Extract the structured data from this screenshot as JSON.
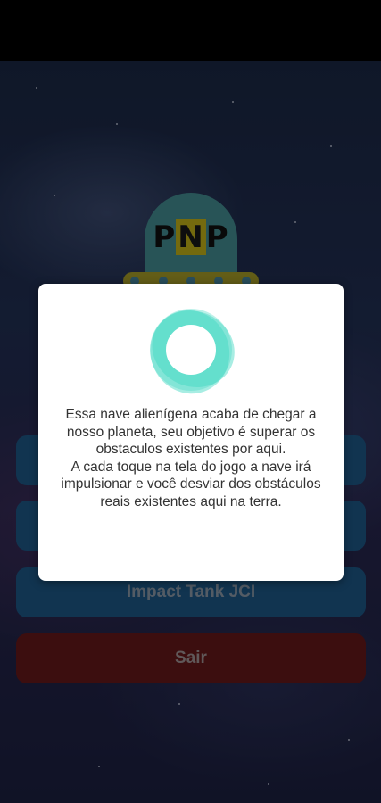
{
  "logo": {
    "letters": [
      "P",
      "N",
      "P"
    ]
  },
  "menu": {
    "impact_label": "Impact Tank JCI",
    "exit_label": "Sair"
  },
  "dialog": {
    "paragraph1": "Essa nave alienígena acaba de chegar a nosso planeta, seu objetivo é superar os obstaculos existentes por aqui.",
    "paragraph2": "A cada toque na tela do jogo a nave irá impulsionar e você desviar dos obstáculos reais existentes aqui na terra.",
    "loader_icon": "spinner-icon"
  },
  "colors": {
    "button_blue": "#1f5f93",
    "button_red": "#6e1a1c",
    "loader_teal": "#3fd6c0",
    "ufo_dome": "#4a9a9e",
    "ufo_rim": "#b5aa2a"
  }
}
